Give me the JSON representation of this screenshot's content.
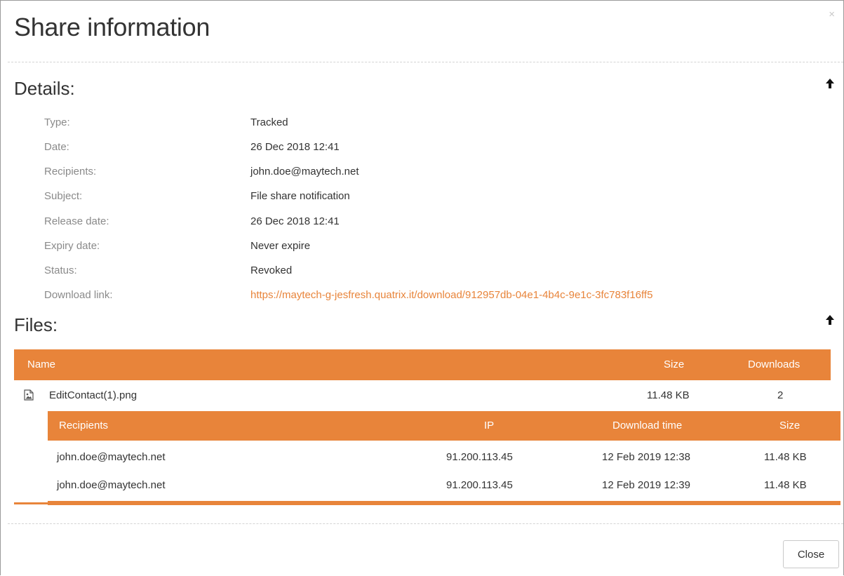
{
  "dialog": {
    "title": "Share information",
    "close_glyph": "×",
    "close_button_label": "Close"
  },
  "details": {
    "heading": "Details:",
    "rows": [
      {
        "label": "Type:",
        "value": "Tracked"
      },
      {
        "label": "Date:",
        "value": "26 Dec 2018 12:41"
      },
      {
        "label": "Recipients:",
        "value": "john.doe@maytech.net"
      },
      {
        "label": "Subject:",
        "value": "File share notification"
      },
      {
        "label": "Release date:",
        "value": "26 Dec 2018 12:41"
      },
      {
        "label": "Expiry date:",
        "value": "Never expire"
      },
      {
        "label": "Status:",
        "value": "Revoked"
      },
      {
        "label": "Download link:",
        "value": "https://maytech-g-jesfresh.quatrix.it/download/912957db-04e1-4b4c-9e1c-3fc783f16ff5"
      }
    ]
  },
  "files": {
    "heading": "Files:",
    "columns": {
      "name": "Name",
      "size": "Size",
      "downloads": "Downloads"
    },
    "items": [
      {
        "icon": "image-file-icon",
        "name": "EditContact(1).png",
        "size": "11.48 KB",
        "downloads": "2",
        "downloads_table": {
          "columns": {
            "recipients": "Recipients",
            "ip": "IP",
            "download_time": "Download time",
            "size": "Size"
          },
          "rows": [
            {
              "recipient": "john.doe@maytech.net",
              "ip": "91.200.113.45",
              "time": "12 Feb 2019 12:38",
              "size": "11.48 KB"
            },
            {
              "recipient": "john.doe@maytech.net",
              "ip": "91.200.113.45",
              "time": "12 Feb 2019 12:39",
              "size": "11.48 KB"
            }
          ]
        }
      }
    ]
  },
  "colors": {
    "accent": "#e8843a",
    "label_gray": "#8a8a8a",
    "text": "#333333"
  },
  "icons": {
    "collapse": "arrow-up-icon",
    "close": "close-icon",
    "file": "image-file-icon"
  }
}
